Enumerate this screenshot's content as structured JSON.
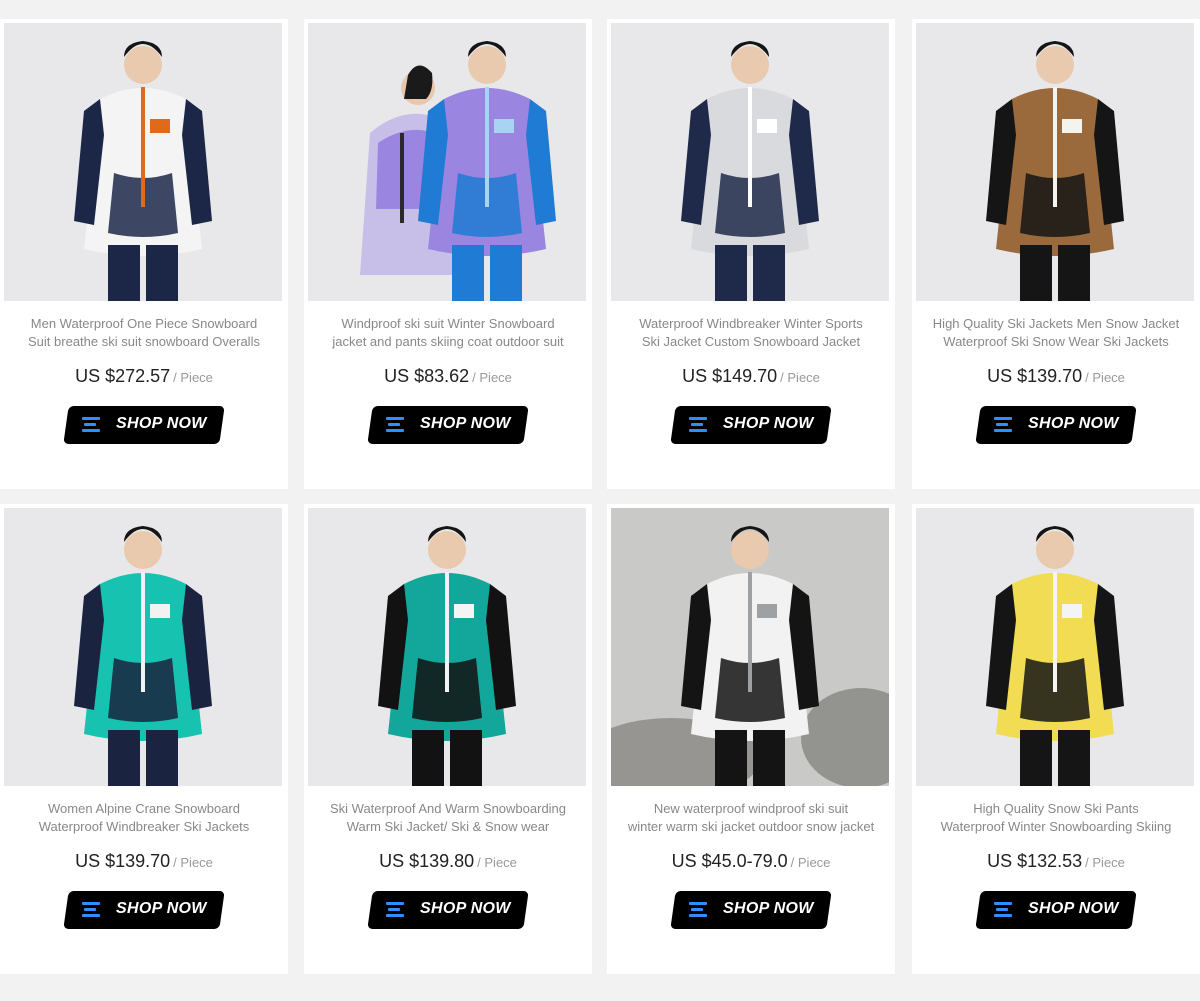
{
  "products": [
    {
      "title_line1": "Men Waterproof One Piece Snowboard",
      "title_line2": "Suit breathe ski suit snowboard Overalls",
      "price": "US $272.57",
      "unit": "/ Piece",
      "button_label": "SHOP NOW",
      "image_desc": "man in white and navy one-piece ski suit",
      "colors": {
        "main": "#f4f4f4",
        "accent": "#1c2748",
        "trim": "#e06a1a",
        "bg": "#e8e8ea"
      }
    },
    {
      "title_line1": "Windproof ski suit Winter Snowboard",
      "title_line2": "jacket and pants skiing coat outdoor suit",
      "price": "US $83.62",
      "unit": "/ Piece",
      "button_label": "SHOP NOW",
      "image_desc": "couple in purple and blue ski jackets",
      "colors": {
        "main": "#9a86e0",
        "accent": "#1f7bd4",
        "trim": "#a9d3f2",
        "bg": "#e8e8ea"
      }
    },
    {
      "title_line1": "Waterproof Windbreaker Winter Sports",
      "title_line2": "Ski Jacket Custom Snowboard Jacket",
      "price": "US $149.70",
      "unit": "/ Piece",
      "button_label": "SHOP NOW",
      "image_desc": "man in light grey and navy ski jacket",
      "colors": {
        "main": "#d9dadd",
        "accent": "#1f2a4a",
        "trim": "#ffffff",
        "bg": "#e8e8ea"
      }
    },
    {
      "title_line1": "High Quality Ski Jackets Men Snow Jacket",
      "title_line2": "Waterproof Ski Snow Wear Ski Jackets",
      "price": "US $139.70",
      "unit": "/ Piece",
      "button_label": "SHOP NOW",
      "image_desc": "man in brown, black and white anorak",
      "colors": {
        "main": "#9a6a3d",
        "accent": "#151515",
        "trim": "#f4f4ee",
        "bg": "#e8e8ea"
      }
    },
    {
      "title_line1": "Women Alpine Crane Snowboard",
      "title_line2": "Waterproof Windbreaker Ski Jackets",
      "price": "US $139.70",
      "unit": "/ Piece",
      "button_label": "SHOP NOW",
      "image_desc": "woman in teal and navy ski jacket",
      "colors": {
        "main": "#18c2b0",
        "accent": "#1a2340",
        "trim": "#f2f2f2",
        "bg": "#e8e8ea"
      }
    },
    {
      "title_line1": "Ski Waterproof And Warm Snowboarding",
      "title_line2": "Warm Ski Jacket/ Ski & Snow wear",
      "price": "US $139.80",
      "unit": "/ Piece",
      "button_label": "SHOP NOW",
      "image_desc": "woman in teal, black and white anorak",
      "colors": {
        "main": "#12a79a",
        "accent": "#121212",
        "trim": "#f4f4f4",
        "bg": "#e8e8ea"
      }
    },
    {
      "title_line1": "New waterproof windproof ski suit",
      "title_line2": "winter warm ski jacket outdoor snow jacket",
      "price": "US $45.0-79.0",
      "unit": "/ Piece",
      "button_label": "SHOP NOW",
      "image_desc": "man with goggles in white, grey and black ski jacket",
      "colors": {
        "main": "#f2f2f2",
        "accent": "#141414",
        "trim": "#9ea1a4",
        "bg": "#c9cac8"
      }
    },
    {
      "title_line1": "High Quality Snow Ski Pants",
      "title_line2": "Waterproof Winter Snowboarding Skiing",
      "price": "US $132.53",
      "unit": "/ Piece",
      "button_label": "SHOP NOW",
      "image_desc": "man in yellow and white ski bib pants",
      "colors": {
        "main": "#f1dc54",
        "accent": "#151515",
        "trim": "#f4f4f4",
        "bg": "#e8e8ea"
      }
    }
  ]
}
